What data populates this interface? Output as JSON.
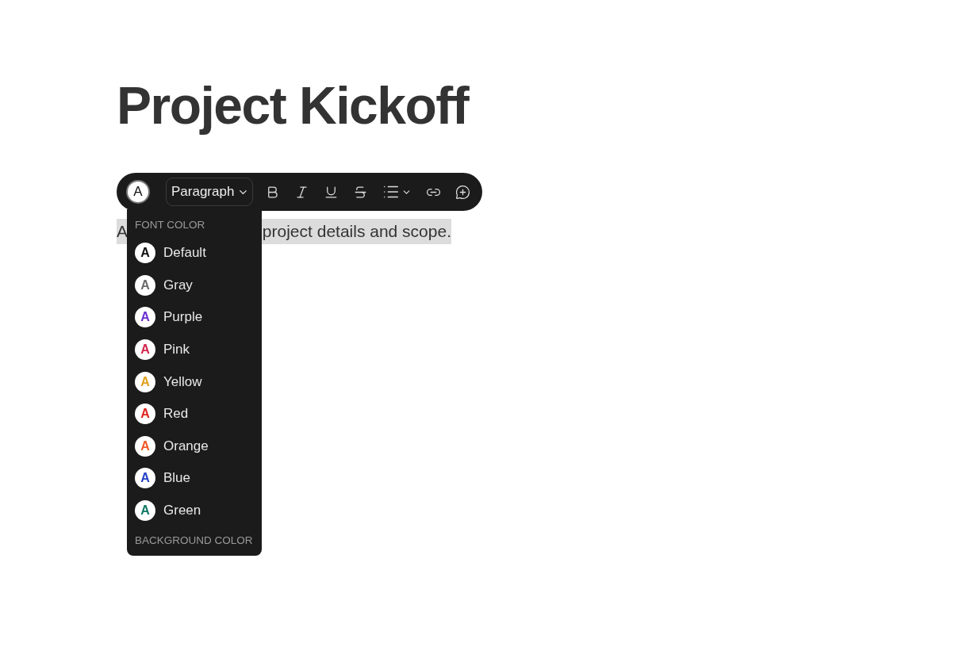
{
  "title": "Project Kickoff",
  "toolbar": {
    "color_button": "A",
    "block_type": "Paragraph",
    "tools": [
      {
        "kind": "bold"
      },
      {
        "kind": "italic"
      },
      {
        "kind": "underline"
      },
      {
        "kind": "strike"
      },
      {
        "kind": "list"
      },
      {
        "kind": "link"
      },
      {
        "kind": "comment"
      }
    ]
  },
  "paragraph": {
    "visible_start": "A",
    "visible_end": "project details and scope.",
    "selected": true
  },
  "color_menu": {
    "font_heading": "FONT COLOR",
    "items": [
      {
        "glyph": "A",
        "label": "Default",
        "color": "#111111"
      },
      {
        "glyph": "A",
        "label": "Gray",
        "color": "#6b6b6b"
      },
      {
        "glyph": "A",
        "label": "Purple",
        "color": "#6b2fd1"
      },
      {
        "glyph": "A",
        "label": "Pink",
        "color": "#d1264f"
      },
      {
        "glyph": "A",
        "label": "Yellow",
        "color": "#e0a020"
      },
      {
        "glyph": "A",
        "label": "Red",
        "color": "#e0261e"
      },
      {
        "glyph": "A",
        "label": "Orange",
        "color": "#ef5a28"
      },
      {
        "glyph": "A",
        "label": "Blue",
        "color": "#2641c4"
      },
      {
        "glyph": "A",
        "label": "Green",
        "color": "#0f7a65"
      }
    ],
    "background_heading": "BACKGROUND COLOR"
  }
}
